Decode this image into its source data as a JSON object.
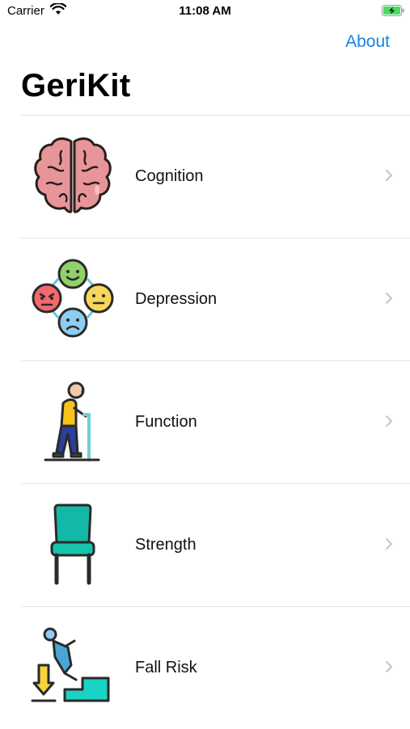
{
  "status_bar": {
    "carrier": "Carrier",
    "time": "11:08 AM",
    "battery_color": "#4cd964"
  },
  "nav": {
    "about_label": "About",
    "title": "GeriKit",
    "accent_color": "#1a82e2"
  },
  "items": [
    {
      "label": "Cognition",
      "icon": "brain-icon"
    },
    {
      "label": "Depression",
      "icon": "emotions-faces-icon"
    },
    {
      "label": "Function",
      "icon": "elderly-person-cane-icon"
    },
    {
      "label": "Strength",
      "icon": "chair-icon"
    },
    {
      "label": "Fall Risk",
      "icon": "falling-stairs-icon"
    }
  ]
}
